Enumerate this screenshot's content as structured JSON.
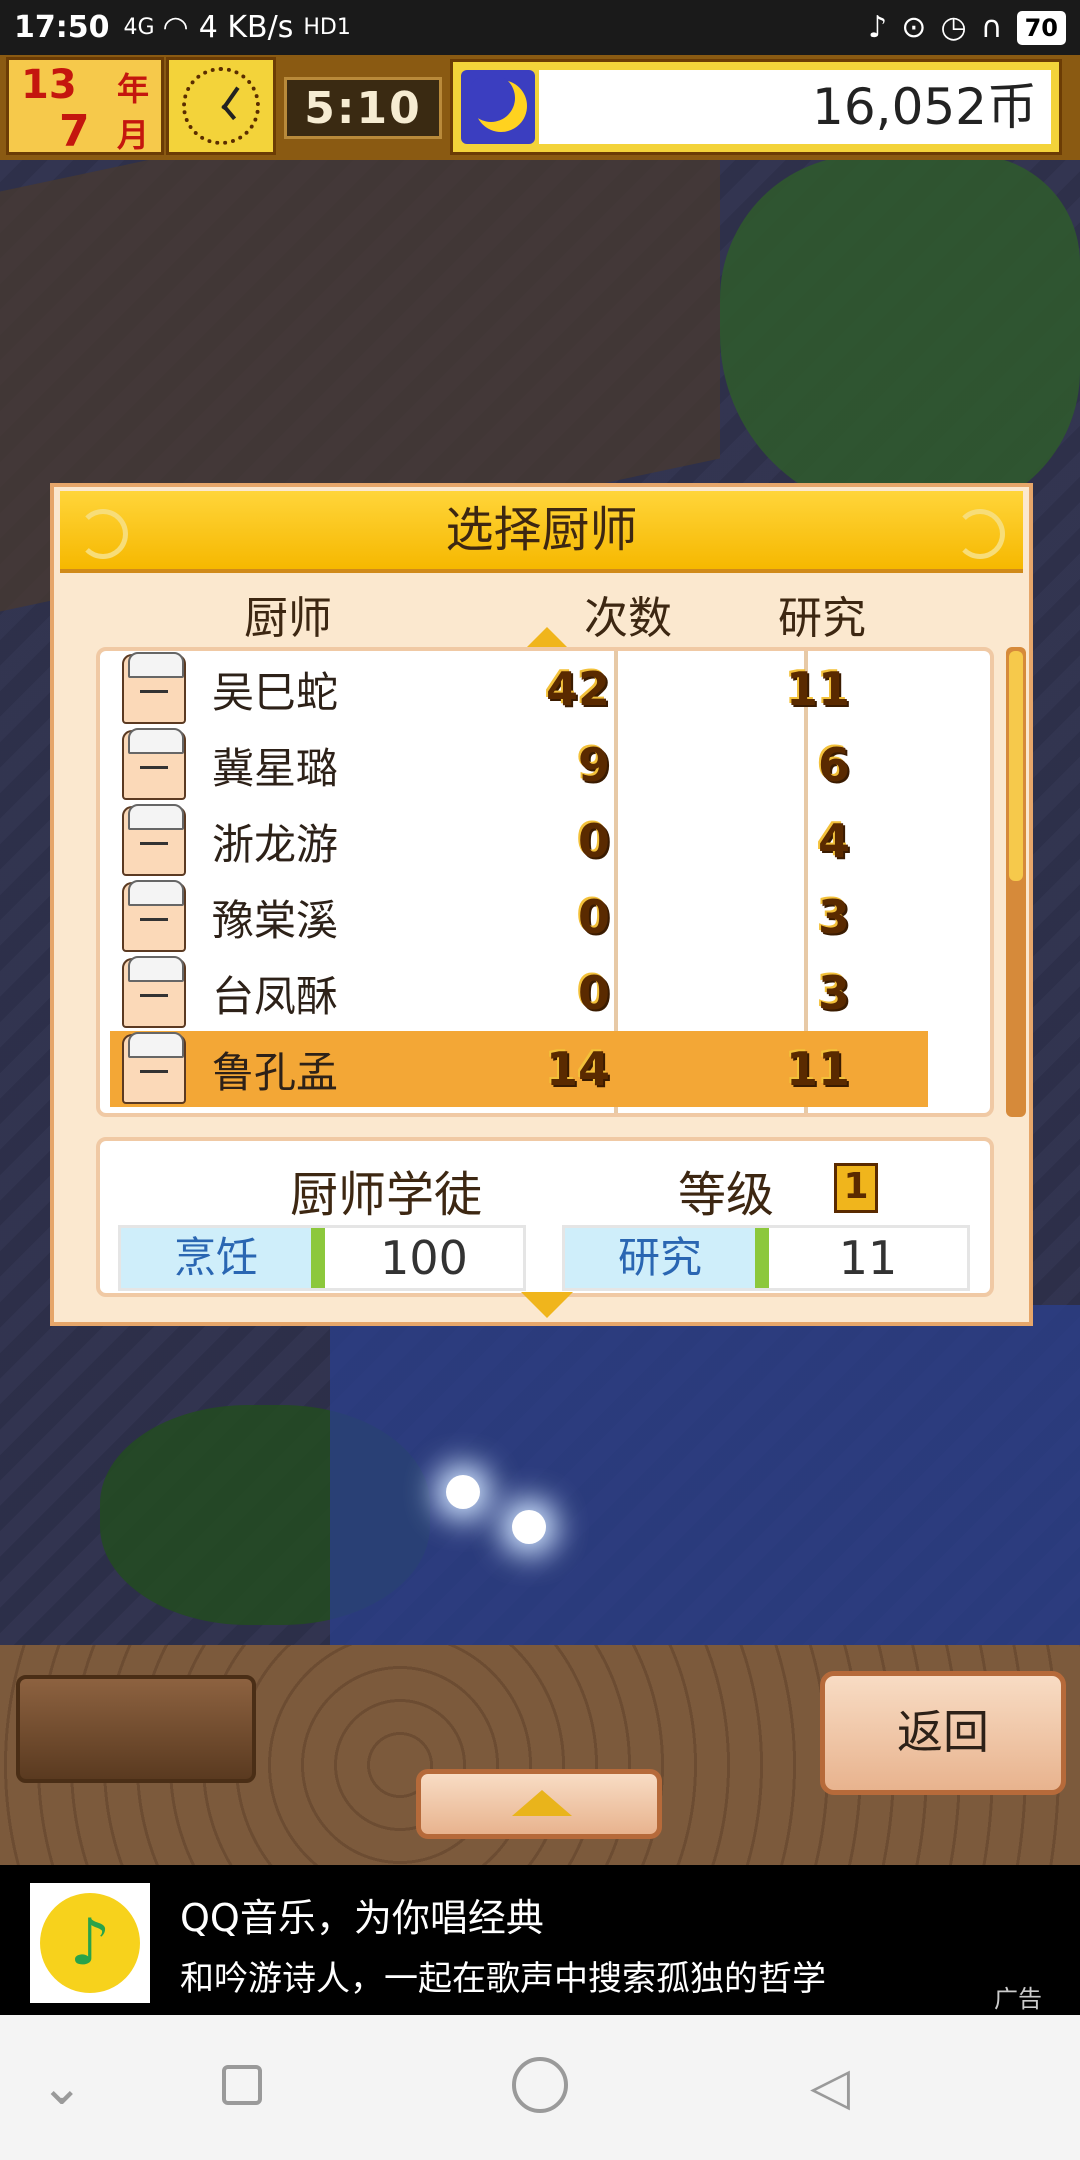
{
  "status_bar": {
    "time": "17:50",
    "network": "4G",
    "speed": "4 KB/s",
    "hd": "HD1",
    "battery": "70"
  },
  "hud": {
    "year_number": "13",
    "year_unit": "年",
    "month_number": "7",
    "month_unit": "月",
    "clock_time": "5:10",
    "money": "16,052币",
    "clock_icon": "clock-icon",
    "night_icon": "moon-icon"
  },
  "dialog": {
    "title": "选择厨师",
    "col_chef": "厨师",
    "col_count": "次数",
    "col_research": "研究",
    "chefs": [
      {
        "name": "吴巳蛇",
        "count": "42",
        "research": "11"
      },
      {
        "name": "冀星璐",
        "count": "9",
        "research": "6"
      },
      {
        "name": "浙龙游",
        "count": "0",
        "research": "4"
      },
      {
        "name": "豫棠溪",
        "count": "0",
        "research": "3"
      },
      {
        "name": "台凤酥",
        "count": "0",
        "research": "3"
      },
      {
        "name": "鲁孔孟",
        "count": "14",
        "research": "11"
      }
    ],
    "selected_index": 5,
    "detail": {
      "title": "厨师学徒",
      "level_label": "等级",
      "level": "1",
      "cooking_label": "烹饪",
      "cooking_value": "100",
      "research_label": "研究",
      "research_value": "11"
    }
  },
  "bottom": {
    "back_label": "返回"
  },
  "ad": {
    "title": "QQ音乐，为你唱经典",
    "subtitle": "和吟游诗人，一起在歌声中搜索孤独的哲学",
    "tag": "广告"
  },
  "colors": {
    "selected_row": "#f3a736",
    "title_bar": "#f6b800",
    "dialog_bg": "#fbe8cf"
  }
}
